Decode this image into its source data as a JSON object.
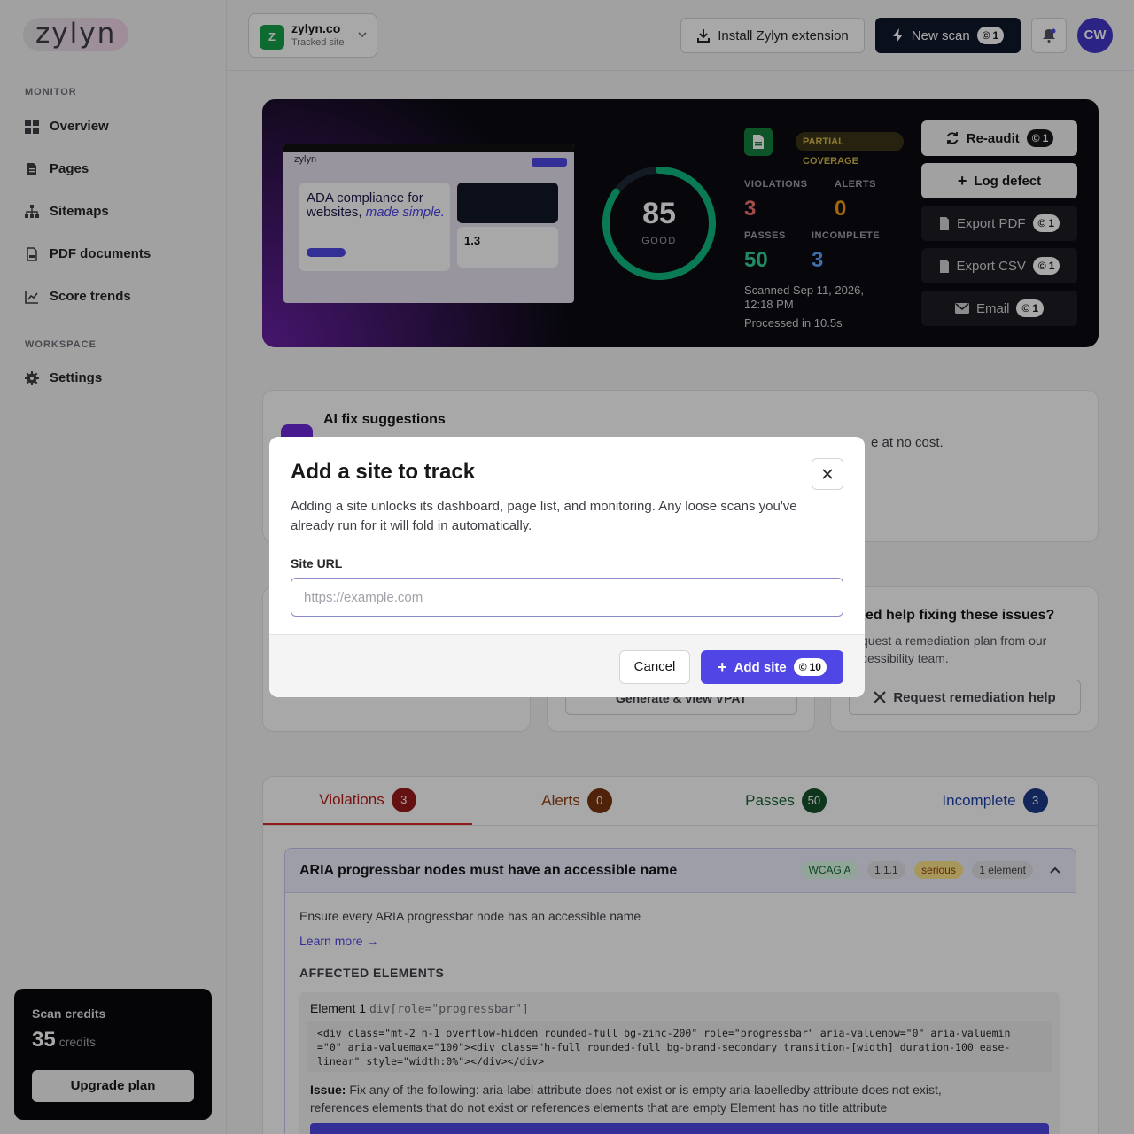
{
  "brand": {
    "logo": "zylyn"
  },
  "sidebar": {
    "monitor_label": "MONITOR",
    "items": [
      {
        "label": "Overview"
      },
      {
        "label": "Pages"
      },
      {
        "label": "Sitemaps"
      },
      {
        "label": "PDF documents"
      },
      {
        "label": "Score trends"
      }
    ],
    "workspace_label": "WORKSPACE",
    "settings_label": "Settings",
    "credits": {
      "title": "Scan credits",
      "count": "35",
      "unit": "credits",
      "upgrade": "Upgrade plan"
    }
  },
  "header": {
    "site": {
      "initial": "Z",
      "name": "zylyn.co",
      "subtitle": "Tracked site"
    },
    "install_ext": "Install Zylyn extension",
    "new_scan": "New scan",
    "new_scan_cost": "1",
    "avatar": "CW"
  },
  "hero": {
    "score": "85",
    "score_label": "GOOD",
    "score_value": 0.85,
    "coverage": "PARTIAL COVERAGE",
    "violations_label": "VIOLATIONS",
    "violations": "3",
    "alerts_label": "ALERTS",
    "alerts": "0",
    "passes_label": "PASSES",
    "passes": "50",
    "incomplete_label": "INCOMPLETE",
    "incomplete": "3",
    "scanned": "Scanned Sep 11, 2026, 12:18 PM",
    "processed": "Processed in 10.5s",
    "thumb": {
      "logo": "zylyn",
      "headline1": "ADA compliance for",
      "headline2": "websites,",
      "headline3": "made simple.",
      "metric": "1.3"
    },
    "actions": [
      {
        "label": "Re-audit",
        "cost": "1"
      },
      {
        "label": "Log defect"
      },
      {
        "label": "Export PDF",
        "cost": "1"
      },
      {
        "label": "Export CSV",
        "cost": "1"
      },
      {
        "label": "Email",
        "cost": "1"
      }
    ]
  },
  "ai": {
    "title": "AI fix suggestions",
    "tail": "e at no cost."
  },
  "help": {
    "title": "eed help fixing these issues?",
    "desc1": "quest a remediation plan from our",
    "desc2": "cessibility team.",
    "button": "Request remediation help",
    "vpat": "Generate & view VPAT"
  },
  "tabs": [
    {
      "label": "Violations",
      "count": "3"
    },
    {
      "label": "Alerts",
      "count": "0"
    },
    {
      "label": "Passes",
      "count": "50"
    },
    {
      "label": "Incomplete",
      "count": "3"
    }
  ],
  "rule": {
    "title": "ARIA progressbar nodes must have an accessible name",
    "wcag": "WCAG A",
    "criterion": "1.1.1",
    "impact": "serious",
    "elements": "1 element",
    "desc": "Ensure every ARIA progressbar node has an accessible name",
    "learn": "Learn more →",
    "affected": "AFFECTED ELEMENTS",
    "element_label": "Element 1",
    "selector": "div[role=\"progressbar\"]",
    "code1": "<div class=\"mt-2 h-1 overflow-hidden rounded-full bg-zinc-200\" role=\"progressbar\" aria-valuenow=\"0\" aria-valuemin",
    "code2": "=\"0\" aria-valuemax=\"100\"><div class=\"h-full rounded-full bg-brand-secondary transition-[width] duration-100 ease-",
    "code3": "linear\" style=\"width:0%\"></div></div>",
    "issue_label": "Issue:",
    "issue": "Fix any of the following: aria-label attribute does not exist or is empty aria-labelledby attribute does not exist,",
    "issue2": "references elements that do not exist or references elements that are empty Element has no title attribute"
  },
  "modal": {
    "title": "Add a site to track",
    "desc": "Adding a site unlocks its dashboard, page list, and monitoring. Any loose scans you've already run for it will fold in automatically.",
    "field_label": "Site URL",
    "placeholder": "https://example.com",
    "cancel": "Cancel",
    "submit": "Add site",
    "submit_cost": "10"
  }
}
